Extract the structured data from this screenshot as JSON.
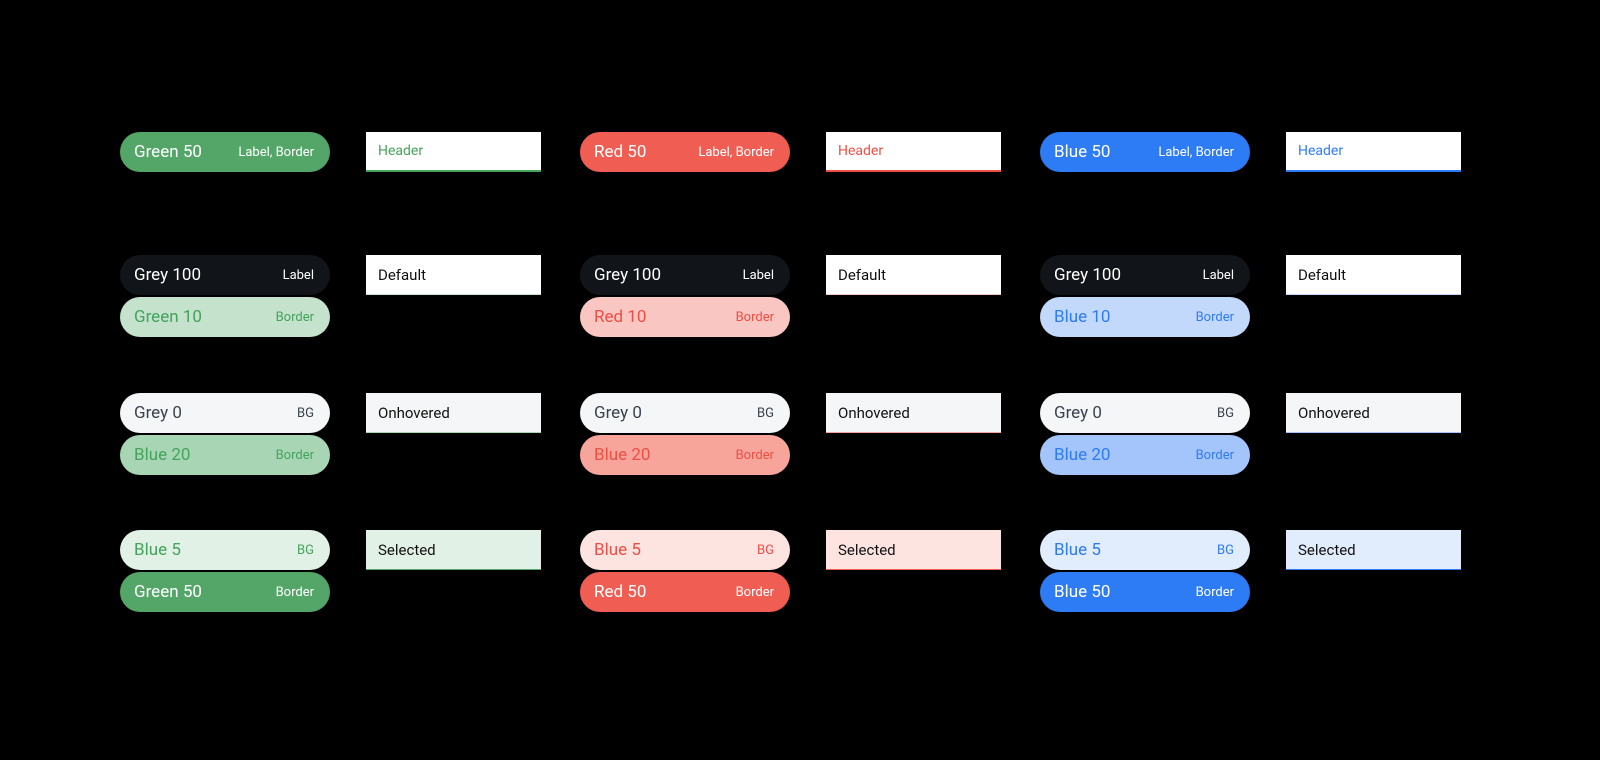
{
  "usage": {
    "label_border": "Label, Border",
    "label": "Label",
    "border": "Border",
    "bg": "BG"
  },
  "swatch": {
    "header": "Header",
    "default": "Default",
    "hover": "Onhovered",
    "selected": "Selected"
  },
  "tokens": {
    "grey_100": "Grey 100",
    "grey_0": "Grey 0",
    "green_50": "Green 50",
    "green_10": "Green 10",
    "red_50": "Red 50",
    "red_10": "Red 10",
    "blue_50": "Blue 50",
    "blue_10": "Blue 10",
    "blue_20": "Blue 20",
    "blue_5": "Blue 5"
  }
}
